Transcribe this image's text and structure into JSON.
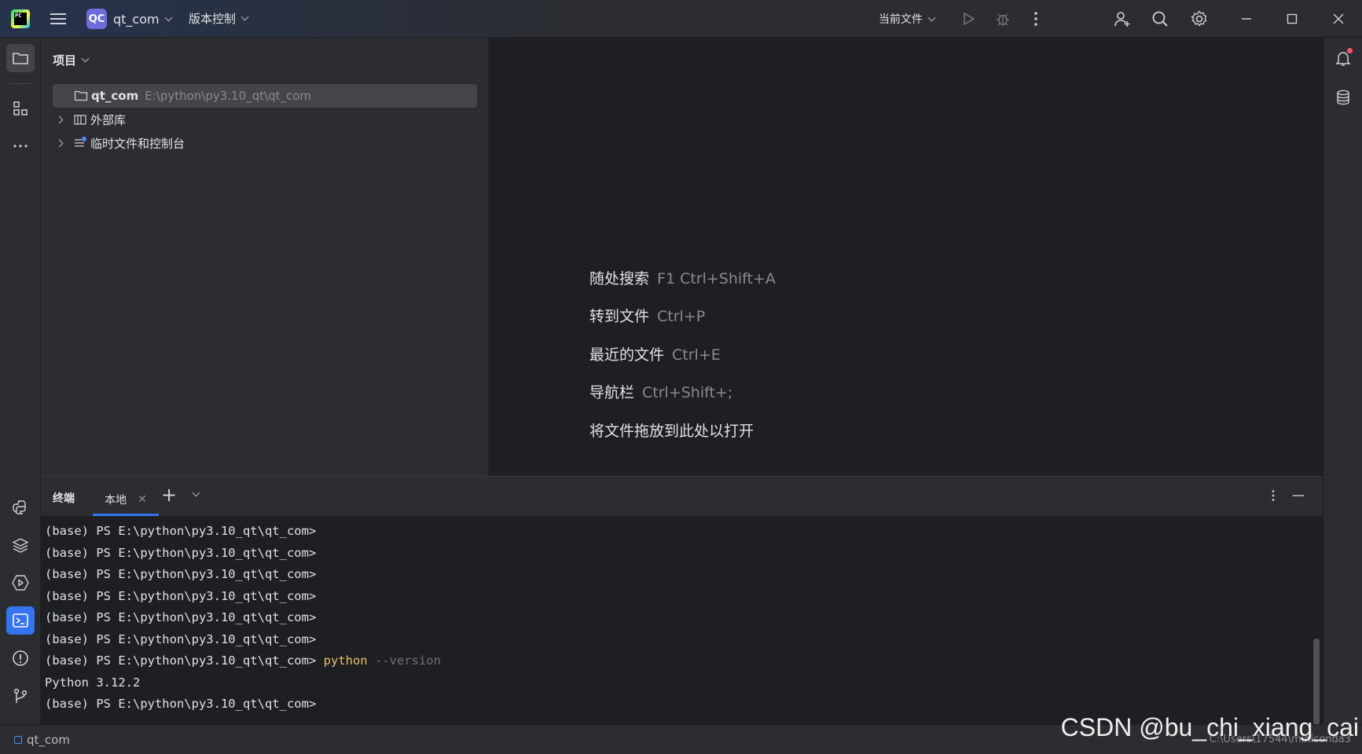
{
  "titlebar": {
    "logo_text": "PC",
    "project_badge": "QC",
    "project_name": "qt_com",
    "vcs_label": "版本控制",
    "run_config": "当前文件"
  },
  "project_panel": {
    "title": "项目",
    "tree": [
      {
        "name": "qt_com",
        "path": "E:\\python\\py3.10_qt\\qt_com"
      },
      {
        "name": "外部库"
      },
      {
        "name": "临时文件和控制台"
      }
    ]
  },
  "editor_hints": [
    {
      "label": "随处搜索",
      "shortcut": "F1 Ctrl+Shift+A"
    },
    {
      "label": "转到文件",
      "shortcut": "Ctrl+P"
    },
    {
      "label": "最近的文件",
      "shortcut": "Ctrl+E"
    },
    {
      "label": "导航栏",
      "shortcut": "Ctrl+Shift+;"
    },
    {
      "label": "将文件拖放到此处以打开",
      "shortcut": ""
    }
  ],
  "terminal": {
    "title": "终端",
    "tab_label": "本地",
    "prompt": "(base) PS E:\\python\\py3.10_qt\\qt_com>",
    "command": "python",
    "command_flag": "--version",
    "output": "Python 3.12.2"
  },
  "statusbar": {
    "project": "qt_com",
    "right_path": "C:\\Users\\17544\\miniconda3"
  },
  "watermark": "CSDN @bu_chi_xiang_cai",
  "colors": {
    "accent": "#3574f0",
    "bg_dark": "#1e1f22",
    "bg_panel": "#2b2d30",
    "command_yellow": "#e8bf6a"
  }
}
